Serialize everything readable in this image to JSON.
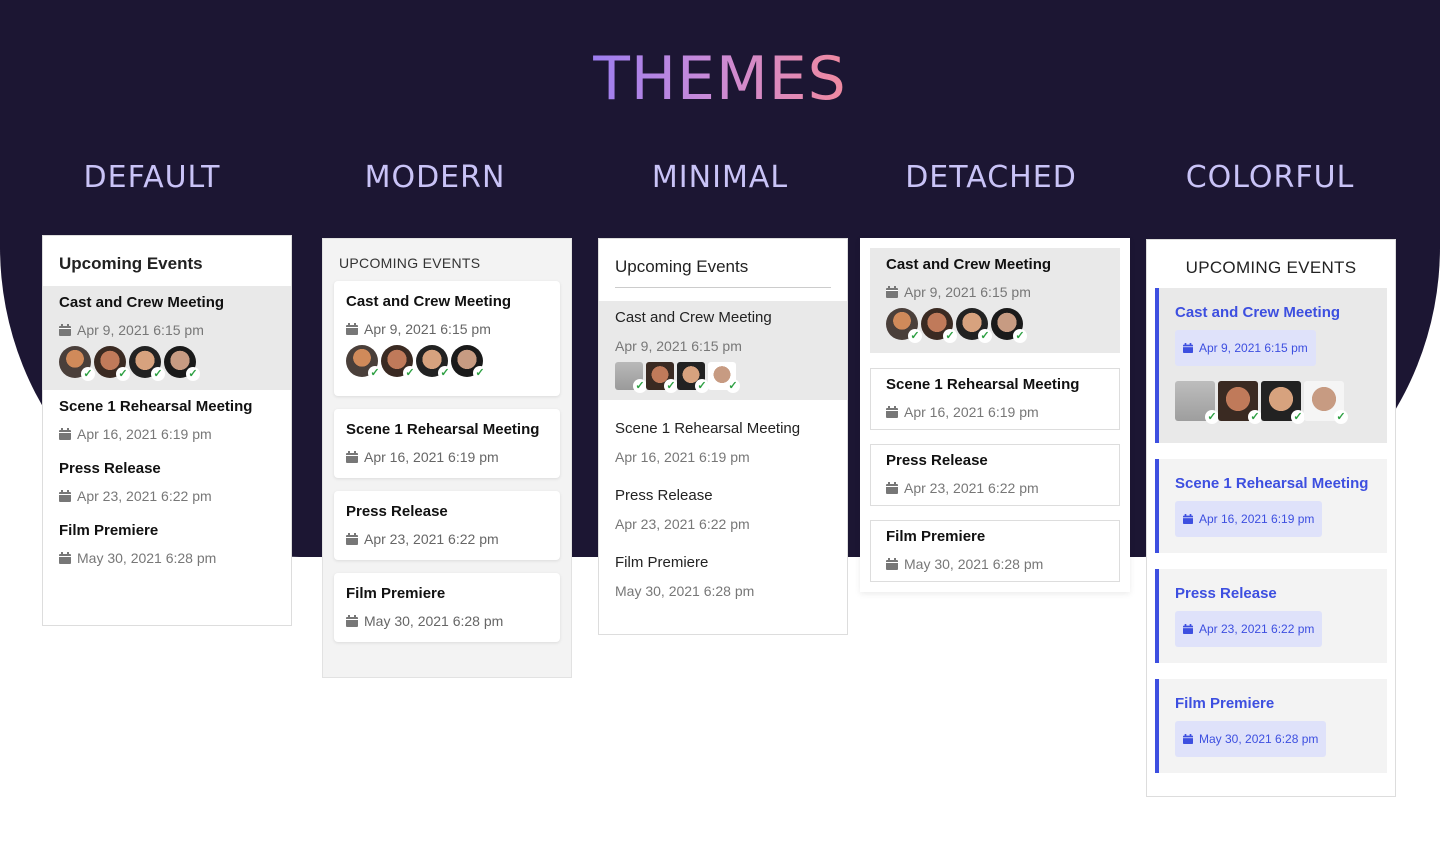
{
  "title": "THEMES",
  "themes": [
    "DEFAULT",
    "MODERN",
    "MINIMAL",
    "DETACHED",
    "COLORFUL"
  ],
  "headers": {
    "default": "Upcoming Events",
    "modern": "UPCOMING EVENTS",
    "minimal": "Upcoming Events",
    "colorful": "UPCOMING EVENTS"
  },
  "events": [
    {
      "title": "Cast and Crew Meeting",
      "date": "Apr 9, 2021 6:15 pm"
    },
    {
      "title": "Scene 1 Rehearsal Meeting",
      "date": "Apr 16, 2021 6:19 pm"
    },
    {
      "title": "Press Release",
      "date": "Apr 23, 2021 6:22 pm"
    },
    {
      "title": "Film Premiere",
      "date": "May 30, 2021 6:28 pm"
    }
  ],
  "colors": {
    "background": "#1c1633",
    "label": "#c9c3f7",
    "accent": "#3d4fe0",
    "check": "#2ea043"
  },
  "icons": {
    "date": "calendar-icon",
    "attendee": "avatar",
    "status": "check-icon"
  }
}
